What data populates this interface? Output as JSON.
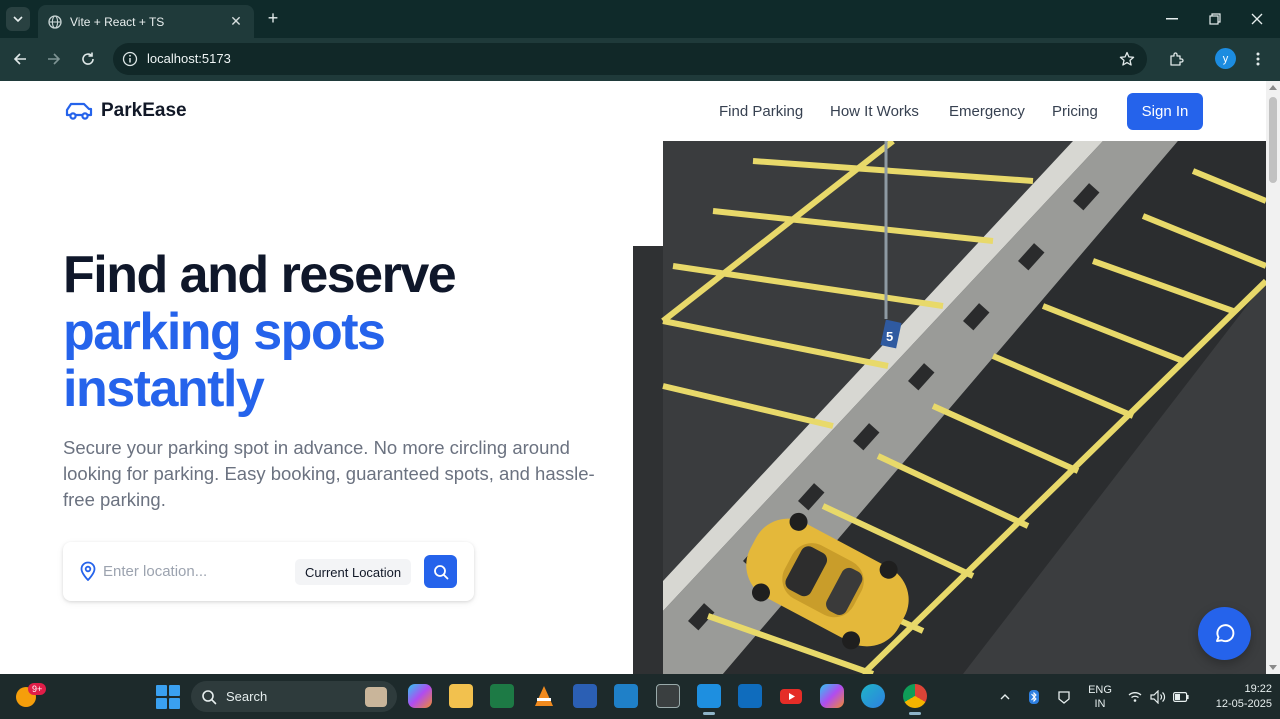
{
  "browser": {
    "tab_title": "Vite + React + TS",
    "url": "localhost:5173",
    "profile_initial": "y"
  },
  "site": {
    "brand": "ParkEase",
    "nav": [
      "Find Parking",
      "How It Works",
      "Emergency",
      "Pricing"
    ],
    "signin_label": "Sign In",
    "hero": {
      "title_line1": "Find and reserve",
      "title_line2": "parking spots",
      "title_line3": "instantly",
      "subtitle": "Secure your parking spot in advance. No more circling around looking for parking. Easy booking, guaranteed spots, and hassle-free parking."
    },
    "search": {
      "placeholder": "Enter location...",
      "current_location_label": "Current Location"
    },
    "image": {
      "spot_number": "5"
    },
    "colors": {
      "primary": "#2563eb",
      "heading": "#0f172a",
      "muted": "#6b7280"
    }
  },
  "taskbar": {
    "weather_badge": "9+",
    "search_label": "Search",
    "apps": [
      "copilot-icon",
      "file-explorer-icon",
      "excel-icon",
      "vlc-icon",
      "word-icon",
      "app-icon",
      "terminal-icon",
      "vscode-icon",
      "outlook-icon",
      "youtube-icon",
      "m365-icon",
      "edge-icon",
      "chrome-icon"
    ],
    "lang_line1": "ENG",
    "lang_line2": "IN",
    "time": "19:22",
    "date": "12-05-2025"
  }
}
